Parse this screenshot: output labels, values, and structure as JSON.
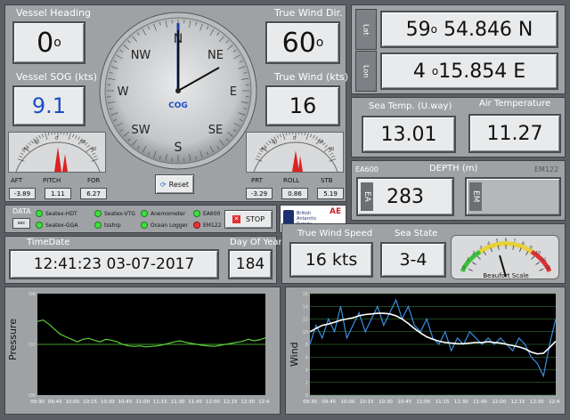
{
  "heading": {
    "title": "Vessel Heading",
    "value": "0",
    "unit": "o"
  },
  "sog": {
    "title": "Vessel SOG (kts)",
    "value": "9.1"
  },
  "wind_dir": {
    "title": "True Wind Dir.",
    "value": "60",
    "unit": "o"
  },
  "wind_speed_top": {
    "title": "True Wind (kts)",
    "value": "16"
  },
  "compass": {
    "labels": [
      "N",
      "NE",
      "E",
      "SE",
      "S",
      "SW",
      "W",
      "NW"
    ],
    "center": "COG",
    "reset": "Reset"
  },
  "pitch": {
    "labels": [
      "AFT",
      "PITCH",
      "FOR"
    ],
    "values": [
      "-3.89",
      "1.11",
      "6.27"
    ],
    "scale": [
      "-40",
      "-30",
      "-20",
      "-10",
      "0",
      "10",
      "20",
      "30",
      "40"
    ]
  },
  "roll": {
    "labels": [
      "PRT",
      "ROLL",
      "STB"
    ],
    "values": [
      "-3.29",
      "0.86",
      "5.19"
    ],
    "scale": [
      "-40",
      "-30",
      "-20",
      "-10",
      "0",
      "10",
      "20",
      "30",
      "40"
    ]
  },
  "position": {
    "lat_label": "Lat",
    "lon_label": "Lon",
    "lat_deg": "59",
    "lat_min": "54.846 N",
    "lon_deg": "4",
    "lon_min": "15.854 E"
  },
  "sea_temp": {
    "title": "Sea Temp. (U.way)",
    "value": "13.01"
  },
  "air_temp": {
    "title": "Air Temperature",
    "value": "11.27"
  },
  "depth": {
    "title": "DEPTH (m)",
    "left": "EA600",
    "right": "EM122",
    "ea_value": "283",
    "ea_tag": "EA",
    "em_tag": "EM"
  },
  "data": {
    "title": "DATA",
    "sec": "sec",
    "items": [
      "Seatex-HDT",
      "Seatex-VTG",
      "Anemometer",
      "EA600",
      "Seatex-GGA",
      "tsshrp",
      "Ocean Logger",
      "EM122"
    ],
    "stop": "STOP"
  },
  "logo": {
    "text": "British Antarctic Survey",
    "tag": "NATURAL ENVIRONMENT RESEARCH COUNCIL"
  },
  "time": {
    "title": "TimeDate",
    "value": "12:41:23 03-07-2017",
    "doy_title": "Day Of Year",
    "doy": "184"
  },
  "wind_speed": {
    "title": "True Wind Speed",
    "value": "16 kts"
  },
  "sea_state": {
    "title": "Sea State",
    "value": "3-4"
  },
  "beaufort": {
    "label": "Beaufort Scale",
    "ticks": [
      "0",
      "1",
      "2",
      "3",
      "4",
      "5",
      "6",
      "7",
      "8",
      "9",
      "10",
      "11",
      "12"
    ]
  },
  "colors": {
    "panel": "#9fa2a5",
    "trace_pressure": "#5dd23a",
    "trace_wind": "#3a8fe0"
  },
  "chart_data": [
    {
      "type": "line",
      "ylabel": "Pressure",
      "ylim": [
        1006,
        1008
      ],
      "yticks": [
        "1006",
        "1007",
        "1008"
      ],
      "xticks": [
        "09:30",
        "09:45",
        "10:00",
        "10:15",
        "10:30",
        "10:45",
        "11:00",
        "11:15",
        "11:30",
        "11:45",
        "12:00",
        "12:15",
        "12:30",
        "12:45"
      ],
      "series": [
        {
          "values": [
            1007.45,
            1007.48,
            1007.4,
            1007.3,
            1007.2,
            1007.15,
            1007.1,
            1007.05,
            1007.1,
            1007.12,
            1007.08,
            1007.05,
            1007.1,
            1007.08,
            1007.05,
            1007.0,
            1006.97,
            1006.96,
            1006.97,
            1006.95,
            1006.96,
            1006.97,
            1006.99,
            1007.02,
            1007.05,
            1007.07,
            1007.04,
            1007.02,
            1007.0,
            1006.98,
            1006.97,
            1006.96,
            1006.98,
            1007.0,
            1007.02,
            1007.04,
            1007.06,
            1007.1,
            1007.07,
            1007.09,
            1007.13
          ]
        }
      ],
      "reference": 1007
    },
    {
      "type": "line",
      "ylabel": "Wind",
      "ylim": [
        0,
        16
      ],
      "yticks": [
        "0",
        "2",
        "4",
        "6",
        "8",
        "10",
        "12",
        "14",
        "16"
      ],
      "xticks": [
        "09:30",
        "09:45",
        "10:00",
        "10:15",
        "10:30",
        "10:45",
        "11:00",
        "11:15",
        "11:30",
        "11:45",
        "12:00",
        "12:15",
        "12:30",
        "12:45"
      ],
      "series": [
        {
          "values": [
            8,
            11,
            9,
            12,
            10,
            14,
            9,
            11,
            13,
            10,
            12,
            14,
            11,
            13,
            15,
            12,
            14,
            11,
            10,
            12,
            9,
            8,
            10,
            7,
            9,
            8,
            10,
            9,
            8,
            9,
            8,
            9,
            8,
            7,
            9,
            8,
            6,
            5,
            3,
            8,
            12
          ]
        },
        {
          "values": [
            10,
            10.5,
            11,
            11.2,
            11.5,
            11.8,
            12,
            12.2,
            12.5,
            12.7,
            12.8,
            12.9,
            12.9,
            12.8,
            12.5,
            12,
            11.3,
            10.5,
            9.8,
            9.2,
            8.8,
            8.5,
            8.3,
            8.2,
            8.1,
            8.1,
            8.2,
            8.3,
            8.3,
            8.4,
            8.3,
            8.2,
            8,
            7.8,
            7.6,
            7.3,
            6.8,
            6.5,
            6.6,
            7.5,
            8.5
          ]
        }
      ]
    }
  ]
}
